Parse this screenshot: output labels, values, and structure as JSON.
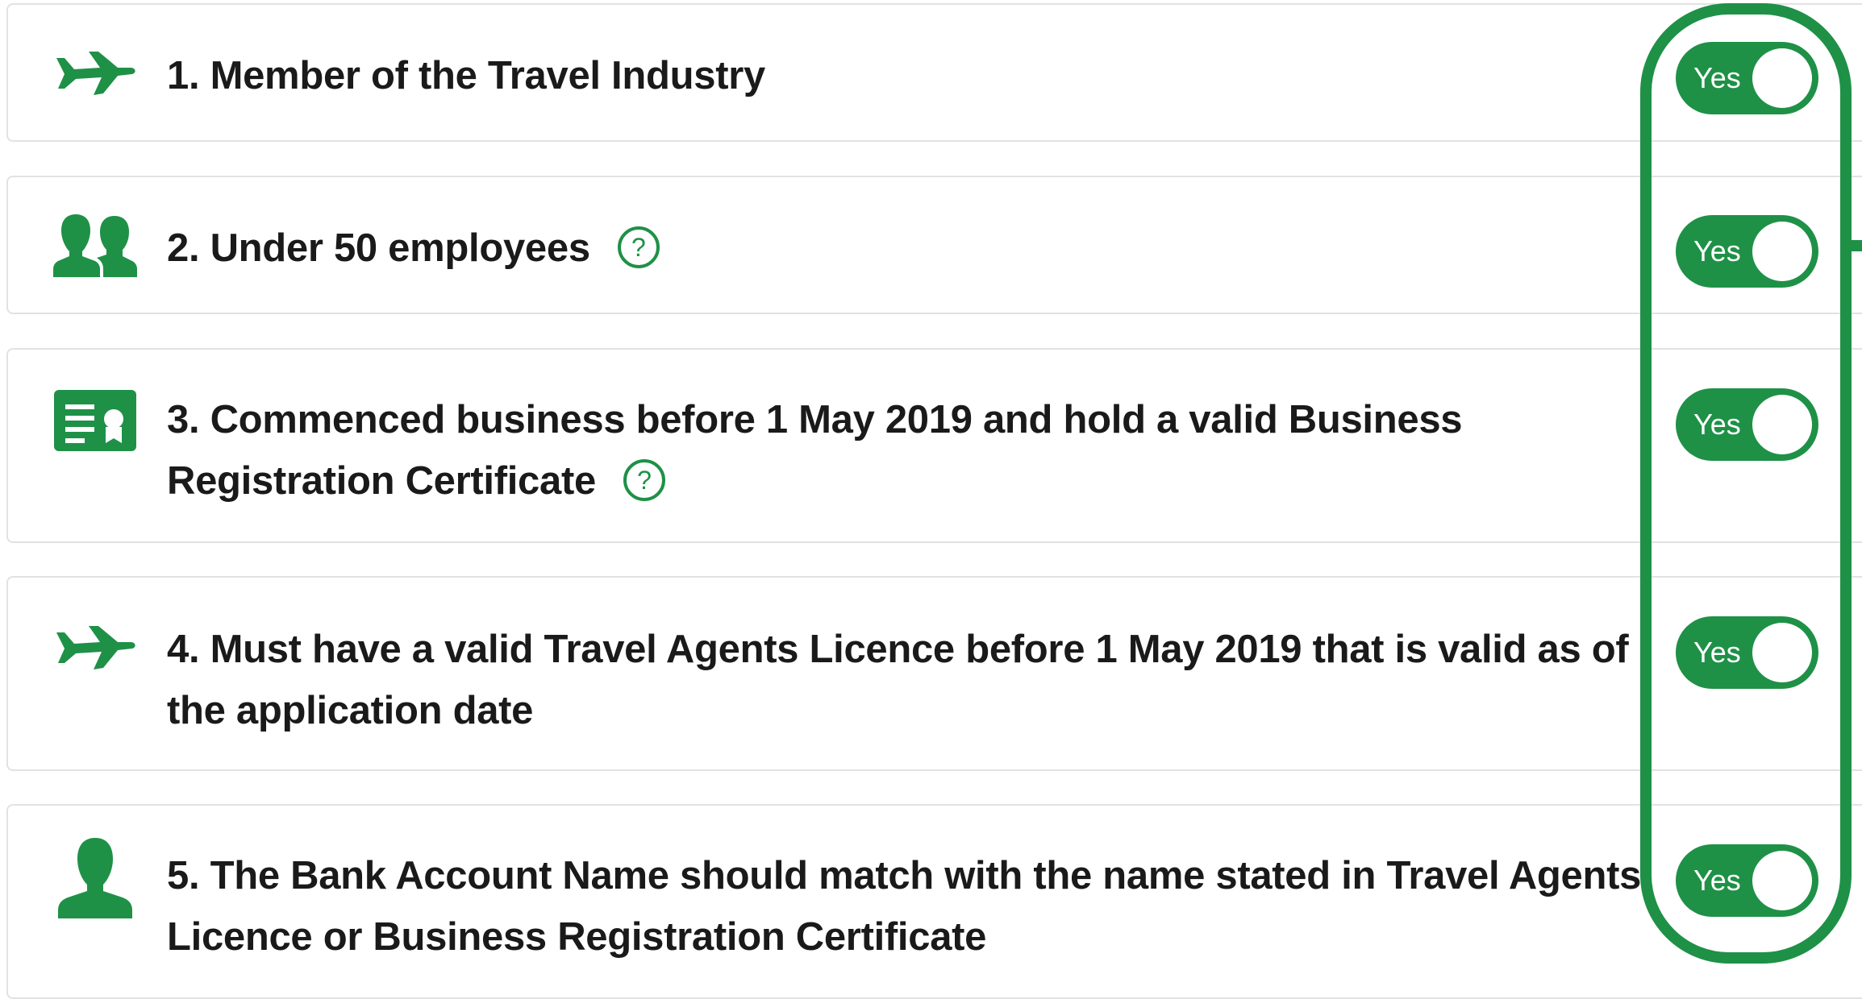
{
  "colors": {
    "accent": "#1e9147",
    "text": "#1a1a1a",
    "card_border": "#e2e2e2"
  },
  "criteria": [
    {
      "icon": "airplane-icon",
      "text": "1. Member of the Travel Industry",
      "help": false,
      "toggle_label": "Yes",
      "toggle_on": true
    },
    {
      "icon": "group-icon",
      "text": "2. Under 50 employees",
      "help": true,
      "toggle_label": "Yes",
      "toggle_on": true
    },
    {
      "icon": "certificate-icon",
      "text_line1": "3. Commenced business before 1 May 2019 and hold a valid Business",
      "text_line2": "Registration Certificate",
      "help": true,
      "toggle_label": "Yes",
      "toggle_on": true
    },
    {
      "icon": "airplane-icon",
      "text_line1": "4. Must have a valid Travel Agents Licence before 1 May 2019 that is valid as of",
      "text_line2": "the application date",
      "help": false,
      "toggle_label": "Yes",
      "toggle_on": true
    },
    {
      "icon": "person-icon",
      "text_line1": "5. The Bank Account Name should match with the name stated in Travel Agents",
      "text_line2": "Licence or Business Registration Certificate",
      "help": false,
      "toggle_label": "Yes",
      "toggle_on": true
    }
  ],
  "help_glyph": "?"
}
